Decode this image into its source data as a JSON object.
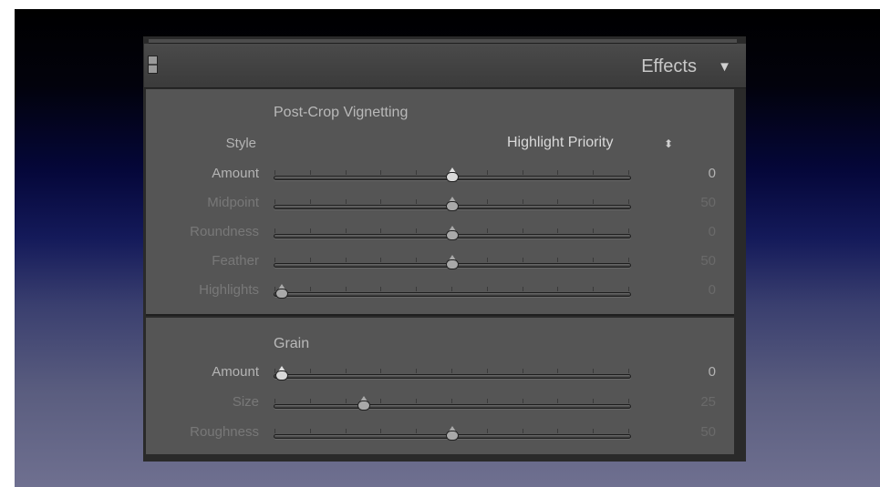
{
  "panel": {
    "title": "Effects",
    "collapse_arrow": "▼"
  },
  "vignette": {
    "title": "Post-Crop Vignetting",
    "style_label": "Style",
    "style_value": "Highlight Priority",
    "style_updown": "⬍",
    "rows": [
      {
        "label": "Amount",
        "value": "0",
        "fraction": 0.5,
        "active": true
      },
      {
        "label": "Midpoint",
        "value": "50",
        "fraction": 0.5,
        "active": false
      },
      {
        "label": "Roundness",
        "value": "0",
        "fraction": 0.5,
        "active": false
      },
      {
        "label": "Feather",
        "value": "50",
        "fraction": 0.5,
        "active": false
      },
      {
        "label": "Highlights",
        "value": "0",
        "fraction": 0.02,
        "active": false
      }
    ]
  },
  "grain": {
    "title": "Grain",
    "rows": [
      {
        "label": "Amount",
        "value": "0",
        "fraction": 0.02,
        "active": true
      },
      {
        "label": "Size",
        "value": "25",
        "fraction": 0.25,
        "active": false
      },
      {
        "label": "Roughness",
        "value": "50",
        "fraction": 0.5,
        "active": false
      }
    ]
  },
  "colors": {
    "label_active": "#b4b4b4",
    "label_dim": "#787878",
    "value_active": "#b4b4b4",
    "value_dim": "#6a6a6a"
  }
}
